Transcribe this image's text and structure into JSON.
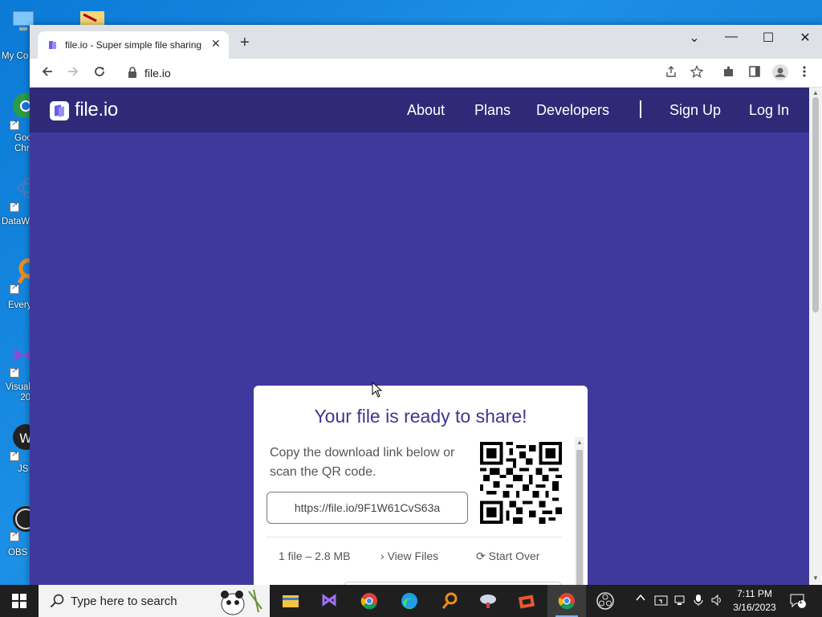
{
  "desktop": {
    "icons": [
      {
        "label": "My Co"
      },
      {
        "label": "Goo Chr"
      },
      {
        "label": "DataW"
      },
      {
        "label": "Every"
      },
      {
        "label": "Visual 20"
      },
      {
        "label": "JS"
      },
      {
        "label": "OBS S"
      }
    ]
  },
  "browser": {
    "tab_title": "file.io - Super simple file sharing",
    "tab_close": "✕",
    "new_tab": "+",
    "url": "file.io",
    "window_controls": {
      "dropdown": "⌄",
      "minimize": "—",
      "maximize": "☐",
      "close": "✕"
    }
  },
  "site": {
    "brand": "file.io",
    "nav": [
      "About",
      "Plans",
      "Developers",
      "Sign Up",
      "Log In"
    ]
  },
  "card": {
    "heading": "Your file is ready to share!",
    "instructions": "Copy the download link below or scan the QR code.",
    "link": "https://file.io/9F1W61CvS63a",
    "file_info": "1 file – 2.8 MB",
    "view_files": "View Files",
    "start_over": "Start Over"
  },
  "taskbar": {
    "search_placeholder": "Type here to search",
    "time": "7:11 PM",
    "date": "3/16/2023",
    "notification_count": "1"
  },
  "colors": {
    "page_bg": "#40399d",
    "navbar_bg": "#2f2a78",
    "heading": "#3d3790",
    "desktop": "#0a7ad6"
  }
}
